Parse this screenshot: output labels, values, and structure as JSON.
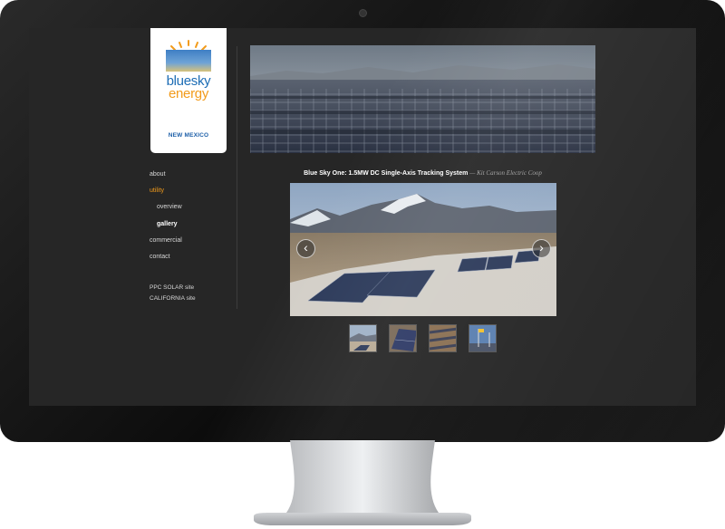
{
  "logo": {
    "line1": "bluesky",
    "line2": "energy",
    "region": "NEW MEXICO"
  },
  "nav": {
    "items": [
      {
        "label": "about",
        "state": "normal"
      },
      {
        "label": "utility",
        "state": "active"
      },
      {
        "label": "overview",
        "state": "sub"
      },
      {
        "label": "gallery",
        "state": "current"
      },
      {
        "label": "commercial",
        "state": "normal"
      },
      {
        "label": "contact",
        "state": "normal"
      }
    ],
    "external": [
      "PPC SOLAR site",
      "CALIFORNIA site"
    ]
  },
  "gallery": {
    "caption_title": "Blue Sky One: 1.5MW DC Single-Axis Tracking System",
    "caption_credit": " — Kit Carson Electric Coop",
    "prev_symbol": "‹",
    "next_symbol": "›",
    "thumbnail_count": 4
  },
  "colors": {
    "accent_orange": "#f29b1b",
    "logo_blue": "#1d6db5",
    "screen_bg": "#262626"
  }
}
